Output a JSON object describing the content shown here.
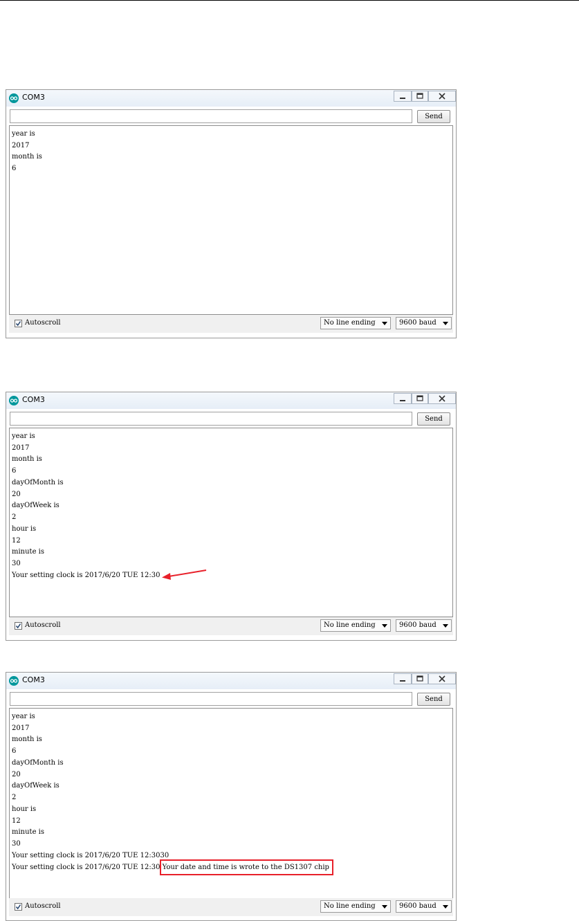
{
  "windows": [
    {
      "title": "COM3",
      "send_label": "Send",
      "input_value": "",
      "output_lines": [
        "year is",
        "2017",
        "month is",
        "6"
      ],
      "autoscroll_label": "Autoscroll",
      "autoscroll_checked": true,
      "line_ending": "No line ending",
      "baud": "9600 baud"
    },
    {
      "title": "COM3",
      "send_label": "Send",
      "input_value": "",
      "output_lines": [
        "year is",
        "2017",
        "month is",
        "6",
        "dayOfMonth is",
        "20",
        "dayOfWeek is",
        "2",
        "hour is",
        "12",
        "minute is",
        "30",
        "Your setting clock is 2017/6/20 TUE 12:30"
      ],
      "autoscroll_label": "Autoscroll",
      "autoscroll_checked": true,
      "line_ending": "No line ending",
      "baud": "9600 baud"
    },
    {
      "title": "COM3",
      "send_label": "Send",
      "input_value": "",
      "output_lines": [
        "year is",
        "2017",
        "month is",
        "6",
        "dayOfMonth is",
        "20",
        "dayOfWeek is",
        "2",
        "hour is",
        "12",
        "minute is",
        "30",
        "Your setting clock is 2017/6/20 TUE 12:3030",
        "Your setting clock is 2017/6/20 TUE 12:30 Your date and time is wrote to the DS1307 chip"
      ],
      "autoscroll_label": "Autoscroll",
      "autoscroll_checked": true,
      "line_ending": "No line ending",
      "baud": "9600 baud"
    }
  ],
  "colors": {
    "annotation_red": "#e8202a",
    "arduino_teal": "#00979c"
  }
}
